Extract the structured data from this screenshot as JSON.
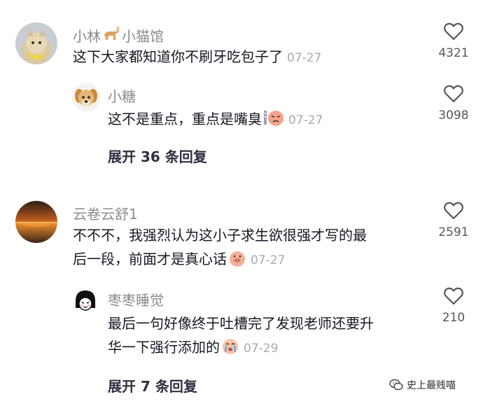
{
  "comments": [
    {
      "name_a": "小林",
      "name_b": "小猫馆",
      "text": "这下大家都知道你不刷牙吃包子了",
      "date": "07-27",
      "likes": "4321",
      "reply": {
        "name": "小糖",
        "text": "这不是重点，重点是嘴臭",
        "date": "07-27",
        "likes": "3098"
      },
      "expand_label": "展开 36 条回复"
    },
    {
      "name": "云卷云舒1",
      "text_line1": "不不不，我强烈认为这小子求生欲很强才写的最",
      "text_line2": "后一段，前面才是真心话",
      "date": "07-27",
      "likes": "2591",
      "reply": {
        "name": "枣枣睡觉",
        "text_line1": "最后一句好像终于吐槽完了发现老师还要升",
        "text_line2": "华一下强行添加的",
        "date": "07-29",
        "likes": "210"
      },
      "expand_label": "展开 7 条回复"
    }
  ],
  "watermark": {
    "text": "史上最贱喵"
  },
  "colors": {
    "name": "#8a8b91",
    "text": "#161823",
    "date": "#a8a9ae",
    "count": "#55565c"
  }
}
